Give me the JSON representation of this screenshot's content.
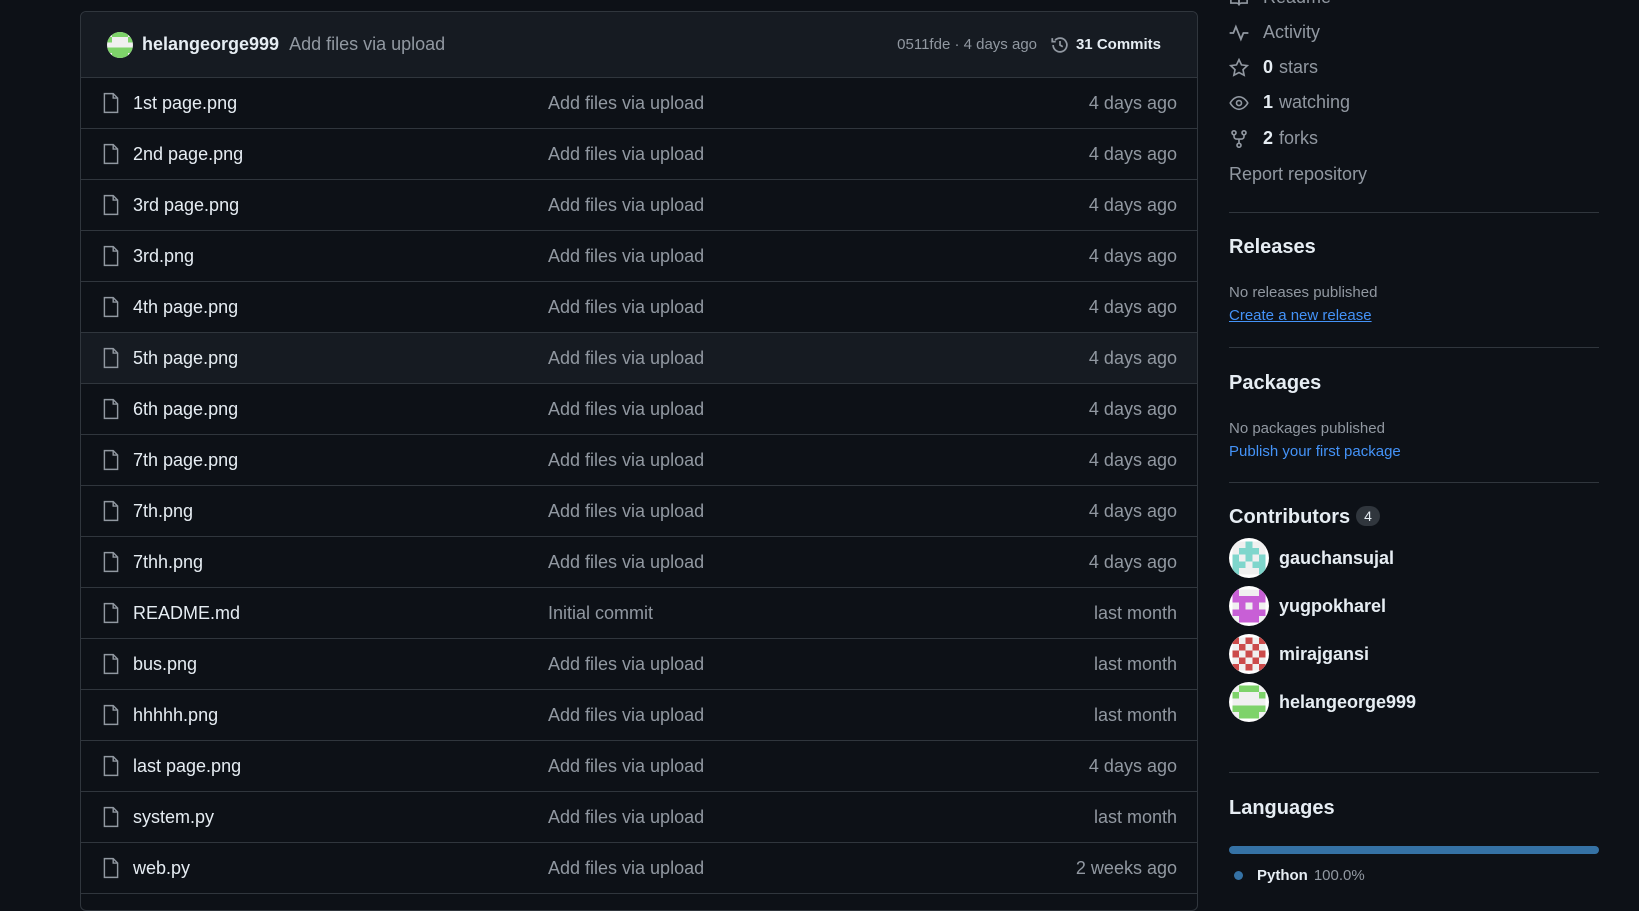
{
  "commit": {
    "author": "helangeorge999",
    "message": "Add files via upload",
    "meta": "0511fde · 4 days ago",
    "commits_label": "31 Commits"
  },
  "files": [
    {
      "name": "1st page.png",
      "message": "Add files via upload",
      "date": "4 days ago"
    },
    {
      "name": "2nd page.png",
      "message": "Add files via upload",
      "date": "4 days ago"
    },
    {
      "name": "3rd page.png",
      "message": "Add files via upload",
      "date": "4 days ago"
    },
    {
      "name": "3rd.png",
      "message": "Add files via upload",
      "date": "4 days ago"
    },
    {
      "name": "4th page.png",
      "message": "Add files via upload",
      "date": "4 days ago"
    },
    {
      "name": "5th page.png",
      "message": "Add files via upload",
      "date": "4 days ago"
    },
    {
      "name": "6th page.png",
      "message": "Add files via upload",
      "date": "4 days ago"
    },
    {
      "name": "7th page.png",
      "message": "Add files via upload",
      "date": "4 days ago"
    },
    {
      "name": "7th.png",
      "message": "Add files via upload",
      "date": "4 days ago"
    },
    {
      "name": "7thh.png",
      "message": "Add files via upload",
      "date": "4 days ago"
    },
    {
      "name": "README.md",
      "message": "Initial commit",
      "date": "last month"
    },
    {
      "name": "bus.png",
      "message": "Add files via upload",
      "date": "last month"
    },
    {
      "name": "hhhhh.png",
      "message": "Add files via upload",
      "date": "last month"
    },
    {
      "name": "last page.png",
      "message": "Add files via upload",
      "date": "4 days ago"
    },
    {
      "name": "system.py",
      "message": "Add files via upload",
      "date": "last month"
    },
    {
      "name": "web.py",
      "message": "Add files via upload",
      "date": "2 weeks ago"
    }
  ],
  "sidebar": {
    "readme": "Readme",
    "activity": "Activity",
    "stars_count": "0",
    "stars_label": "stars",
    "watching_count": "1",
    "watching_label": "watching",
    "forks_count": "2",
    "forks_label": "forks",
    "report": "Report repository",
    "releases": {
      "title": "Releases",
      "empty": "No releases published",
      "link": "Create a new release"
    },
    "packages": {
      "title": "Packages",
      "empty": "No packages published",
      "link": "Publish your first package"
    },
    "contributors": {
      "title": "Contributors",
      "count": "4",
      "people": [
        {
          "name": "gauchansujal",
          "color": "#7fd6cc"
        },
        {
          "name": "yugpokharel",
          "color": "#c85fd6"
        },
        {
          "name": "mirajgansi",
          "color": "#cc4b4b"
        },
        {
          "name": "helangeorge999",
          "color": "#7ed36a"
        }
      ]
    },
    "languages": {
      "title": "Languages",
      "name": "Python",
      "percent": "100.0%",
      "color": "#3572a5"
    }
  }
}
